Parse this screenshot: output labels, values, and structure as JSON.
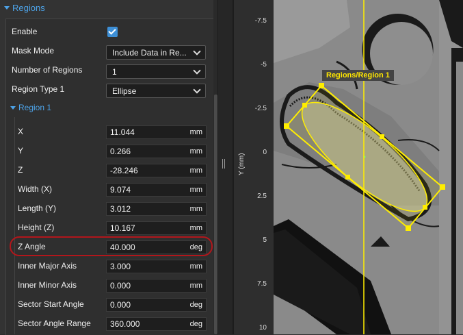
{
  "left_panel": {
    "section_title": "Regions",
    "enable": {
      "label": "Enable",
      "checked": true
    },
    "mask_mode": {
      "label": "Mask Mode",
      "value": "Include Data in Re..."
    },
    "number_of_regions": {
      "label": "Number of Regions",
      "value": "1"
    },
    "region_type": {
      "label": "Region Type 1",
      "value": "Ellipse"
    },
    "region1": {
      "title": "Region 1",
      "fields": [
        {
          "label": "X",
          "value": "11.044",
          "unit": "mm"
        },
        {
          "label": "Y",
          "value": "0.266",
          "unit": "mm"
        },
        {
          "label": "Z",
          "value": "-28.246",
          "unit": "mm"
        },
        {
          "label": "Width (X)",
          "value": "9.074",
          "unit": "mm"
        },
        {
          "label": "Length (Y)",
          "value": "3.012",
          "unit": "mm"
        },
        {
          "label": "Height (Z)",
          "value": "10.167",
          "unit": "mm"
        },
        {
          "label": "Z Angle",
          "value": "40.000",
          "unit": "deg"
        },
        {
          "label": "Inner Major Axis",
          "value": "3.000",
          "unit": "mm"
        },
        {
          "label": "Inner Minor Axis",
          "value": "0.000",
          "unit": "mm"
        },
        {
          "label": "Sector Start Angle",
          "value": "0.000",
          "unit": "deg"
        },
        {
          "label": "Sector Angle Range",
          "value": "360.000",
          "unit": "deg"
        }
      ]
    }
  },
  "viewer": {
    "y_axis_title": "Y (mm)",
    "y_ticks": [
      "-7.5",
      "-5",
      "-2.5",
      "0",
      "2.5",
      "5",
      "7.5",
      "10"
    ],
    "region_label": "Regions/Region 1",
    "colors": {
      "region": "#ffee00",
      "highlight": "#b3161b",
      "accent": "#4da3e8"
    }
  }
}
